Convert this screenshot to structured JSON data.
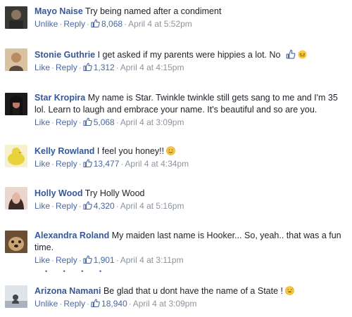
{
  "comments": [
    {
      "author": "Mayo Naise",
      "text": "Try being named after a condiment",
      "action": "Unlike",
      "reply": "Reply",
      "likes": "8,068",
      "time": "April 4 at 5:52pm",
      "avatar_colors": [
        "#2f2d2b",
        "#7b6a58"
      ]
    },
    {
      "author": "Stonie Guthrie",
      "text": "I get asked if my parents were hippies a lot. No",
      "action": "Like",
      "reply": "Reply",
      "likes": "1,312",
      "time": "April 4 at 4:15pm",
      "avatar_colors": [
        "#c9a06e",
        "#5a4a3c"
      ],
      "emojis": [
        "thumbs-up-hand-icon",
        "squinting-face-icon"
      ]
    },
    {
      "author": "Star Kropira",
      "text": "My name is Star. Twinkle twinkle still gets sang to me and I'm 35 lol. Learn to laugh and embrace your name. It's beautiful and so are you.",
      "action": "Like",
      "reply": "Reply",
      "likes": "5,068",
      "time": "April 4 at 3:09pm",
      "avatar_colors": [
        "#1e1a1a",
        "#9c5b4b"
      ]
    },
    {
      "author": "Kelly Rowland",
      "text": "I feel you honey!!",
      "action": "Like",
      "reply": "Reply",
      "likes": "13,477",
      "time": "April 4 at 4:34pm",
      "avatar_colors": [
        "#e8d33a",
        "#bfa41e"
      ],
      "emojis": [
        "smiling-face-icon"
      ]
    },
    {
      "author": "Holly Wood",
      "text": "Try Holly Wood",
      "action": "Like",
      "reply": "Reply",
      "likes": "4,320",
      "time": "April 4 at 5:16pm",
      "avatar_colors": [
        "#d9b7a7",
        "#3b2a26"
      ]
    },
    {
      "author": "Alexandra Roland",
      "text": "My maiden last name is Hooker... So, yeah.. that was a fun time.",
      "action": "Like",
      "reply": "Reply",
      "likes": "1,901",
      "time": "April 4 at 3:11pm",
      "avatar_colors": [
        "#6b4f33",
        "#c9a473"
      ]
    },
    {
      "author": "Arizona Namani",
      "text": "Be glad that u dont have the name of a State !",
      "action": "Unlike",
      "reply": "Reply",
      "likes": "18,940",
      "time": "April 4 at 3:09pm",
      "avatar_colors": [
        "#d6dbe2",
        "#43464d"
      ],
      "emojis": [
        "grinning-sweat-face-icon"
      ]
    }
  ],
  "colors": {
    "author": "#365899",
    "link": "#4b67a1",
    "meta": "#8d949e",
    "text": "#1d2129",
    "emoji_yellow": "#f7c843"
  }
}
